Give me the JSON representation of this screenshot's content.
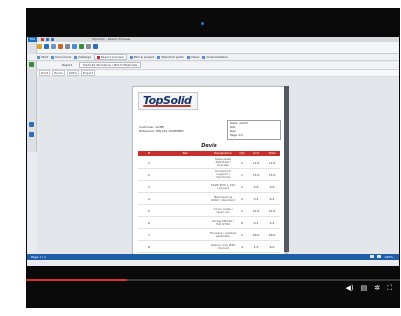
{
  "app": {
    "menu_label": "File",
    "title": "TopSolid – Report Preview"
  },
  "tabs": [
    {
      "label": "Start"
    },
    {
      "label": "Document"
    },
    {
      "label": "Catalogs"
    },
    {
      "label": "Report preview",
      "active": true
    },
    {
      "label": "Part & project"
    },
    {
      "label": "Standard parts"
    },
    {
      "label": "Views"
    },
    {
      "label": "Customization"
    }
  ],
  "report_bar": {
    "label": "Report",
    "value": "TopSolid Workshop / Bill of Materials"
  },
  "toolbar2": {
    "items": [
      "Print",
      "Zoom",
      "100%",
      "Export"
    ]
  },
  "document": {
    "logo": "TopSolid",
    "info_lines": [
      "Date: 12/03",
      "Ref:",
      "Rev:",
      "Page 1/1"
    ],
    "kv_lines": [
      "Customer:   ACME",
      "Reference:   PRJ-001 ASSEMBLY"
    ],
    "title": "Devis",
    "columns": [
      "#",
      "Ref",
      "Designation",
      "Qty",
      "Unit",
      "Total"
    ],
    "rows": [
      {
        "n": "1",
        "ref": "",
        "desc": "Steel plate 200x100 / bracket",
        "qty": "1",
        "unit": "12.0",
        "total": "12.0"
      },
      {
        "n": "2",
        "ref": "",
        "desc": "Aluminium support / machined",
        "qty": "1",
        "unit": "15.5",
        "total": "15.5"
      },
      {
        "n": "3",
        "ref": "",
        "desc": "Shaft Ø20 x 150 / turned",
        "qty": "2",
        "unit": "4.8",
        "total": "9.6"
      },
      {
        "n": "4",
        "ref": "",
        "desc": "Ball bearing 6204 / standard",
        "qty": "2",
        "unit": "3.2",
        "total": "6.4"
      },
      {
        "n": "5",
        "ref": "",
        "desc": "Cover plate / laser cut",
        "qty": "1",
        "unit": "22.0",
        "total": "22.0"
      },
      {
        "n": "6",
        "ref": "",
        "desc": "Screw M6x20 / ISO 4762",
        "qty": "8",
        "unit": "0.3",
        "total": "2.4"
      },
      {
        "n": "7",
        "ref": "",
        "desc": "Housing / welded assembly",
        "qty": "1",
        "unit": "48.0",
        "total": "48.0"
      },
      {
        "n": "8",
        "ref": "",
        "desc": "Spacer ring Ø30 / turned",
        "qty": "4",
        "unit": "1.5",
        "total": "6.0"
      },
      {
        "n": "9",
        "ref": "",
        "desc": "Base frame / profile 40x40",
        "qty": "1",
        "unit": "36.0",
        "total": "36.0"
      }
    ]
  },
  "statusbar": {
    "left": "Page 1 / 1",
    "right": "100%"
  },
  "video": {
    "progress": 0.27
  },
  "colors": {
    "accent": "#1f5fa8",
    "header": "#c9302c",
    "progress": "#d93025"
  }
}
